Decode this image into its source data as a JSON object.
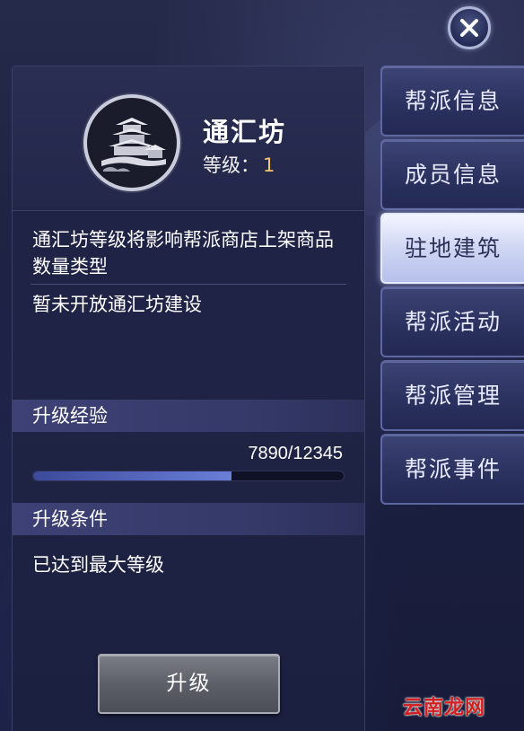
{
  "close": {
    "icon": "close-icon"
  },
  "building": {
    "name": "通汇坊",
    "level_label": "等级：",
    "level_value": "1",
    "emblem_icon": "pavilion-emblem-icon",
    "description": "通汇坊等级将影响帮派商店上架商品数量类型",
    "note": "暂未开放通汇坊建设"
  },
  "experience": {
    "section_label": "升级经验",
    "progress_text": "7890/12345",
    "current": 7890,
    "max": 12345
  },
  "conditions": {
    "section_label": "升级条件",
    "text": "已达到最大等级"
  },
  "upgrade_button": "升级",
  "tabs": [
    {
      "label": "帮派信息",
      "active": false
    },
    {
      "label": "成员信息",
      "active": false
    },
    {
      "label": "驻地建筑",
      "active": true
    },
    {
      "label": "帮派活动",
      "active": false
    },
    {
      "label": "帮派管理",
      "active": false
    },
    {
      "label": "帮派事件",
      "active": false
    }
  ],
  "watermark": "云南龙网",
  "colors": {
    "level_value": "#f3c66a",
    "watermark": "#d02020",
    "active_tab": "#dfe4fa"
  }
}
